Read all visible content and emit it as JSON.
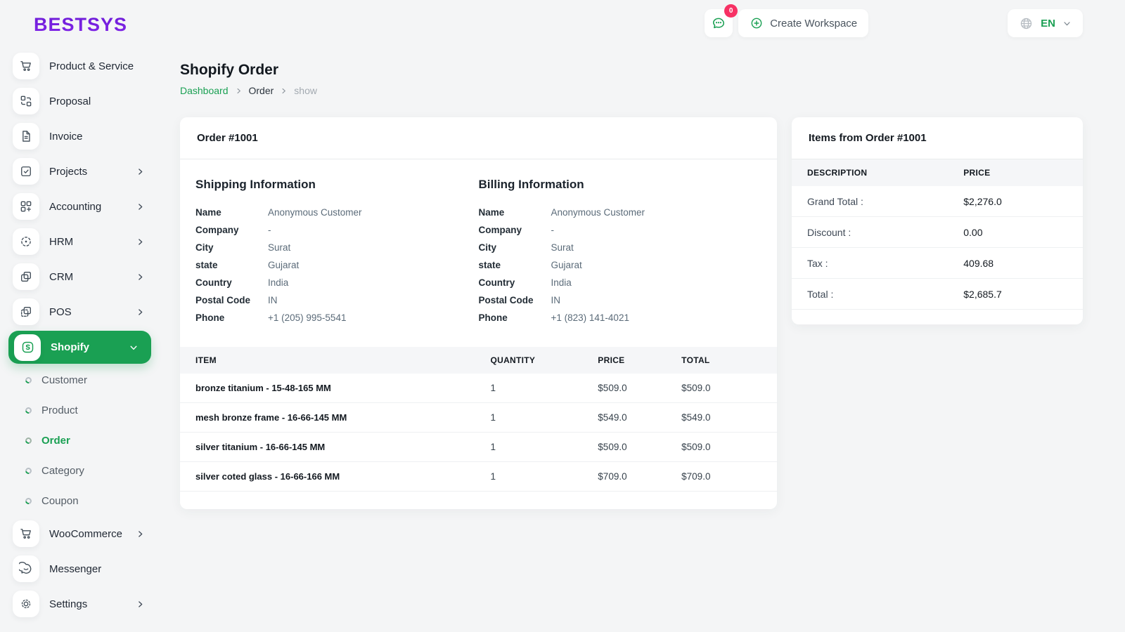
{
  "brand": {
    "logo": "BESTSYS"
  },
  "colors": {
    "primary": "#1aa053",
    "badge_pink": "#f73164",
    "logo_purple_top": "#5a10c9",
    "logo_purple_bottom": "#8d2df0"
  },
  "topbar": {
    "chat_badge": "0",
    "create_workspace_label": "Create Workspace",
    "language": "EN"
  },
  "page": {
    "title": "Shopify Order",
    "breadcrumb": [
      "Dashboard",
      "Order",
      "show"
    ]
  },
  "sidebar": {
    "active_item": "Shopify",
    "active_subitem": "Order",
    "items": [
      {
        "label": "Product & Service"
      },
      {
        "label": "Proposal"
      },
      {
        "label": "Invoice"
      },
      {
        "label": "Projects"
      },
      {
        "label": "Accounting"
      },
      {
        "label": "HRM"
      },
      {
        "label": "CRM"
      },
      {
        "label": "POS"
      },
      {
        "label": "Shopify"
      },
      {
        "label": "WooCommerce"
      },
      {
        "label": "Messenger"
      },
      {
        "label": "Settings"
      }
    ],
    "shopify_submenu": [
      "Customer",
      "Product",
      "Order",
      "Category",
      "Coupon"
    ]
  },
  "order_card": {
    "title": "Order #1001",
    "shipping": {
      "title": "Shipping Information",
      "fields": [
        {
          "label": "Name",
          "value": "Anonymous Customer"
        },
        {
          "label": "Company",
          "value": "-"
        },
        {
          "label": "City",
          "value": "Surat"
        },
        {
          "label": "state",
          "value": "Gujarat"
        },
        {
          "label": "Country",
          "value": "India"
        },
        {
          "label": "Postal Code",
          "value": "IN"
        },
        {
          "label": "Phone",
          "value": "+1 (205) 995-5541"
        }
      ]
    },
    "billing": {
      "title": "Billing Information",
      "fields": [
        {
          "label": "Name",
          "value": "Anonymous Customer"
        },
        {
          "label": "Company",
          "value": "-"
        },
        {
          "label": "City",
          "value": "Surat"
        },
        {
          "label": "state",
          "value": "Gujarat"
        },
        {
          "label": "Country",
          "value": "India"
        },
        {
          "label": "Postal Code",
          "value": "IN"
        },
        {
          "label": "Phone",
          "value": "+1 (823) 141-4021"
        }
      ]
    },
    "items_table": {
      "headers": [
        "ITEM",
        "QUANTITY",
        "PRICE",
        "TOTAL"
      ],
      "rows": [
        {
          "item": "bronze titanium - 15-48-165 MM",
          "quantity": "1",
          "price": "$509.0",
          "total": "$509.0"
        },
        {
          "item": "mesh bronze frame - 16-66-145 MM",
          "quantity": "1",
          "price": "$549.0",
          "total": "$549.0"
        },
        {
          "item": "silver titanium - 16-66-145 MM",
          "quantity": "1",
          "price": "$509.0",
          "total": "$509.0"
        },
        {
          "item": "silver coted glass - 16-66-166 MM",
          "quantity": "1",
          "price": "$709.0",
          "total": "$709.0"
        }
      ]
    }
  },
  "summary_card": {
    "title": "Items from Order #1001",
    "headers": [
      "DESCRIPTION",
      "PRICE"
    ],
    "rows": [
      {
        "label": "Grand Total :",
        "value": "$2,276.0"
      },
      {
        "label": "Discount :",
        "value": "0.00"
      },
      {
        "label": "Tax :",
        "value": "409.68"
      },
      {
        "label": "Total :",
        "value": "$2,685.7"
      }
    ]
  }
}
